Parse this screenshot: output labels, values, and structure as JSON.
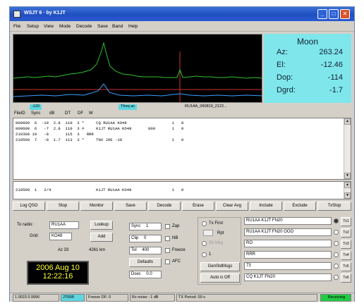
{
  "window": {
    "title": "WSJT 6 · by K1JT",
    "controls": [
      "_",
      "□",
      "✕"
    ]
  },
  "menu": [
    "File",
    "Setup",
    "View",
    "Mode",
    "Decode",
    "Save",
    "Band",
    "Help"
  ],
  "moon": {
    "title": "Moon",
    "az_label": "Az:",
    "az_value": "263.24",
    "el_label": "El:",
    "el_value": "-12.46",
    "dop_label": "Dop:",
    "dop_value": "-114",
    "dgrd_label": "Dgrd:",
    "dgrd_value": "-1.7"
  },
  "freq": {
    "left": "-120",
    "mid": "Tfreq ac",
    "file": "RU1AA_060810_2122..."
  },
  "columns": [
    "FileID",
    "Sync",
    "dB",
    "DT",
    "DF",
    "W"
  ],
  "decodes": [
    "000600  6  -19  2.8  110  3 *     CQ RU1AA KO48                   1   0",
    "000600  6   -7  2.8  110  3 #     K1JT RU1AA KO48       000       1   0",
    "210300 10   -8       115  3   RRR",
    "210500  7   -8  1.7  113  3 *     TNX JOE -18                     1   0"
  ],
  "average": [
    "210500  1   2/4                   K1JT RU1AA KO48                 1   0"
  ],
  "buttons": [
    "Log QSO",
    "Stop",
    "Monitor",
    "Save",
    "Decode",
    "Erase",
    "Clear Avg",
    "Include",
    "Exclude",
    "TxStop"
  ],
  "station": {
    "to_radio_label": "To radio:",
    "to_radio_value": "RU1AA",
    "grid_label": "Grid:",
    "grid_value": "KO48",
    "lookup_btn": "Lookup",
    "add_btn": "Add",
    "az_text": "Az 33",
    "dist_text": "4261 km"
  },
  "clock": {
    "date": "2006 Aug 10",
    "time": "12:22:16"
  },
  "settings": {
    "sync_label": "Sync",
    "sync_value": "1",
    "clip_label": "Clip",
    "clip_value": "0",
    "tol_label": "Tol",
    "tol_value": "400",
    "defaults_btn": "Defaults",
    "dsec_label": "Dsec",
    "dsec_value": "0.0",
    "zap_label": "Zap",
    "nb_label": "NB",
    "freeze_label": "Freeze",
    "afc_label": "AFC"
  },
  "txopts": {
    "tx_first": "Tx First",
    "rpt_label": "Rpt",
    "sh_msg": "Sh Msg",
    "shmsg_value": "1",
    "gen_std": "GenStdMsgs",
    "auto_off": "Auto is Off"
  },
  "messages": [
    "RU1AA K1JT FN20",
    "RU1AA K1JT FN20 OOO",
    "RO",
    "RRR",
    "73",
    "CQ K1JT FN20"
  ],
  "tx_label": "Tx1",
  "tx_labels": [
    "Tx1",
    "Tx2",
    "Tx3",
    "Tx4",
    "Tx5",
    "Tx6"
  ],
  "status": {
    "freq": "1.0023 0.9996",
    "mode": "JT65B",
    "freeze": "Freeze DF: 0",
    "rxnoise": "Rx noise: -1 dB",
    "txperiod": "TX Period: 00 s",
    "state": "Receiving"
  }
}
